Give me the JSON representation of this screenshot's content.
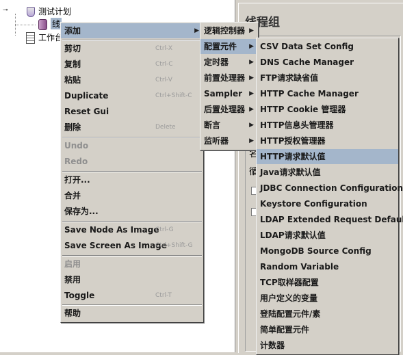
{
  "tree": {
    "root_label": "测试计划",
    "thread_group_label": "线",
    "workbench_label": "工作台"
  },
  "panel": {
    "title": "线程组",
    "label_1": "名",
    "label_2": "循"
  },
  "context_menu": {
    "items": [
      {
        "label": "添加",
        "shortcut": "",
        "submenu": true,
        "enabled": true
      },
      {
        "label": "剪切",
        "shortcut": "Ctrl-X",
        "enabled": true
      },
      {
        "label": "复制",
        "shortcut": "Ctrl-C",
        "enabled": true
      },
      {
        "label": "粘贴",
        "shortcut": "Ctrl-V",
        "enabled": true
      },
      {
        "label": "Duplicate",
        "shortcut": "Ctrl+Shift-C",
        "enabled": true
      },
      {
        "label": "Reset Gui",
        "shortcut": "",
        "enabled": true
      },
      {
        "label": "删除",
        "shortcut": "Delete",
        "enabled": true
      },
      {
        "label": "Undo",
        "shortcut": "",
        "enabled": false
      },
      {
        "label": "Redo",
        "shortcut": "",
        "enabled": false
      },
      {
        "label": "打开...",
        "shortcut": "",
        "enabled": true
      },
      {
        "label": "合并",
        "shortcut": "",
        "enabled": true
      },
      {
        "label": "保存为...",
        "shortcut": "",
        "enabled": true
      },
      {
        "label": "Save Node As Image",
        "shortcut": "Ctrl-G",
        "enabled": true
      },
      {
        "label": "Save Screen As Image",
        "shortcut": "Ctrl+Shift-G",
        "enabled": true
      },
      {
        "label": "启用",
        "shortcut": "",
        "enabled": false
      },
      {
        "label": "禁用",
        "shortcut": "",
        "enabled": true
      },
      {
        "label": "Toggle",
        "shortcut": "Ctrl-T",
        "enabled": true
      },
      {
        "label": "帮助",
        "shortcut": "",
        "enabled": true
      }
    ]
  },
  "add_submenu": {
    "items": [
      {
        "label": "逻辑控制器"
      },
      {
        "label": "配置元件"
      },
      {
        "label": "定时器"
      },
      {
        "label": "前置处理器"
      },
      {
        "label": "Sampler"
      },
      {
        "label": "后置处理器"
      },
      {
        "label": "断言"
      },
      {
        "label": "监听器"
      }
    ]
  },
  "config_submenu": {
    "items": [
      {
        "label": "CSV Data Set Config"
      },
      {
        "label": "DNS Cache Manager"
      },
      {
        "label": "FTP请求缺省值"
      },
      {
        "label": "HTTP Cache Manager"
      },
      {
        "label": "HTTP Cookie 管理器"
      },
      {
        "label": "HTTP信息头管理器"
      },
      {
        "label": "HTTP授权管理器"
      },
      {
        "label": "HTTP请求默认值"
      },
      {
        "label": "Java请求默认值"
      },
      {
        "label": "JDBC Connection Configuration"
      },
      {
        "label": "Keystore Configuration"
      },
      {
        "label": "LDAP Extended Request Defaults"
      },
      {
        "label": "LDAP请求默认值"
      },
      {
        "label": "MongoDB Source Config"
      },
      {
        "label": "Random Variable"
      },
      {
        "label": "TCP取样器配置"
      },
      {
        "label": "用户定义的变量"
      },
      {
        "label": "登陆配置元件/素"
      },
      {
        "label": "简单配置元件"
      },
      {
        "label": "计数器"
      }
    ]
  },
  "colors": {
    "highlight": "#a4b6cb",
    "menu_bg": "#d4d0c8",
    "disabled_text": "#8f8f8f"
  }
}
